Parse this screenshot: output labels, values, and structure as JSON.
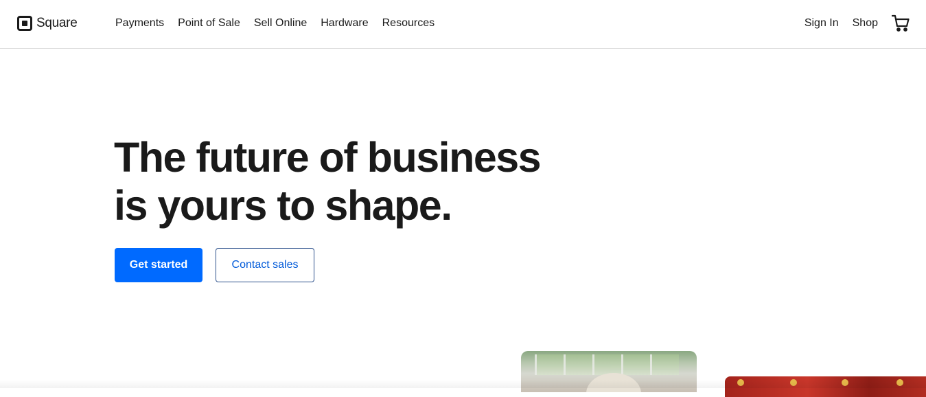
{
  "brand": {
    "name": "Square",
    "logo_icon": "square-logo-icon"
  },
  "nav": {
    "items": [
      {
        "label": "Payments"
      },
      {
        "label": "Point of Sale"
      },
      {
        "label": "Sell Online"
      },
      {
        "label": "Hardware"
      },
      {
        "label": "Resources"
      }
    ],
    "sign_in": "Sign In",
    "shop": "Shop",
    "cart_icon": "cart-icon"
  },
  "hero": {
    "title_line1": "The future of business",
    "title_line2": "is yours to shape.",
    "primary_cta": "Get started",
    "secondary_cta": "Contact sales"
  },
  "colors": {
    "accent": "#006aff",
    "text": "#1a1a1a",
    "secondary_text": "#005ad9"
  }
}
